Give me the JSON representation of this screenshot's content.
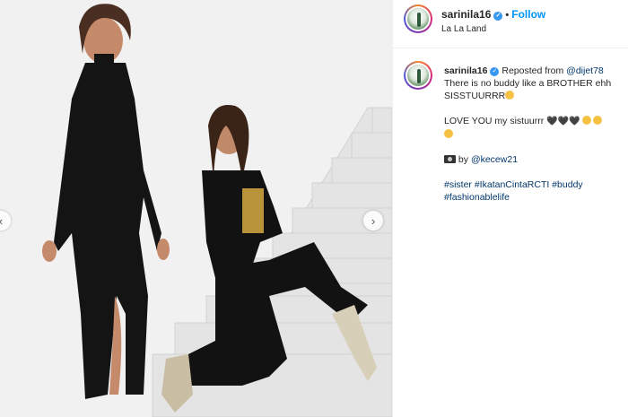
{
  "post": {
    "username": "sarinila16",
    "follow_label": "Follow",
    "separator": "•",
    "location": "La La Land"
  },
  "caption": {
    "username": "sarinila16",
    "reposted_prefix": "Reposted from",
    "reposted_handle": "@dijet78",
    "line1": "There is no buddy like a BROTHER ehh SISSTUURRR",
    "line2": "LOVE YOU my sistuurrr",
    "hearts": "🖤🖤🖤",
    "credit_prefix": "by",
    "credit_handle": "@kecew21",
    "hashtags": "#sister #IkatanCintaRCTI #buddy #fashionablelife"
  },
  "icons": {
    "verified": "verified-badge-icon",
    "avatar": "profile-avatar",
    "camera": "movie-camera-icon",
    "nav_next": "chevron-right-icon",
    "nav_prev": "chevron-left-icon"
  },
  "colors": {
    "link": "#00376b",
    "follow": "#0095f6",
    "verified": "#3897f0",
    "text": "#262626"
  }
}
